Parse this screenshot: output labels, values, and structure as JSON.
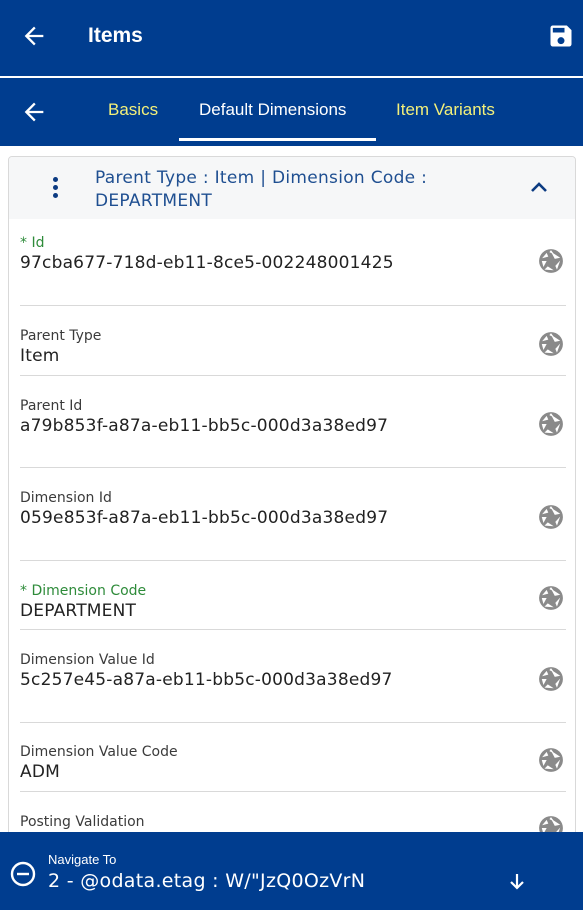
{
  "header": {
    "title": "Items"
  },
  "tabs": [
    {
      "label": "Basics"
    },
    {
      "label": "Default Dimensions"
    },
    {
      "label": "Item Variants"
    }
  ],
  "card": {
    "title": "Parent Type  : Item | Dimension Code  :  DEPARTMENT"
  },
  "fields": [
    {
      "label": "* Id",
      "value": "97cba677-718d-eb11-8ce5-002248001425"
    },
    {
      "label": "Parent Type",
      "value": "Item"
    },
    {
      "label": "Parent Id",
      "value": "a79b853f-a87a-eb11-bb5c-000d3a38ed97"
    },
    {
      "label": "Dimension Id",
      "value": "059e853f-a87a-eb11-bb5c-000d3a38ed97"
    },
    {
      "label": "* Dimension Code",
      "value": "DEPARTMENT"
    },
    {
      "label": "Dimension Value Id",
      "value": "5c257e45-a87a-eb11-bb5c-000d3a38ed97"
    },
    {
      "label": "Dimension Value Code",
      "value": "ADM"
    },
    {
      "label": "Posting Validation",
      "value": ""
    }
  ],
  "bottom": {
    "label": "Navigate To",
    "value": "2 - @odata.etag : W/\"JzQ0OzVrN"
  },
  "colors": {
    "primary": "#003d8f",
    "tab_inactive": "#f3f07a",
    "required_label": "#2e8b3a",
    "card_title": "#1f4f91"
  },
  "icons": {
    "back": "arrow-left-icon",
    "save": "floppy-disk-icon",
    "menu": "kebab-menu-icon",
    "collapse": "chevron-up-icon",
    "field_action": "lens-aperture-icon",
    "navigate": "minus-circle-icon",
    "navigate_down": "arrow-down-icon"
  }
}
